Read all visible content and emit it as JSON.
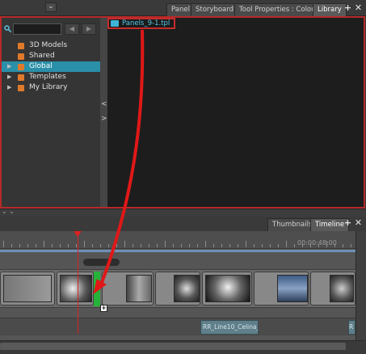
{
  "top_tabs": [
    {
      "label": "Panel",
      "active": false
    },
    {
      "label": "Storyboard",
      "active": false
    },
    {
      "label": "Tool Properties : Colour",
      "active": false
    },
    {
      "label": "Library",
      "active": true
    }
  ],
  "tab_add": "+",
  "tab_close": "✕",
  "library": {
    "search_value": "",
    "folders": [
      {
        "label": "3D Models",
        "expandable": false,
        "selected": false
      },
      {
        "label": "Shared",
        "expandable": false,
        "selected": false
      },
      {
        "label": "Global",
        "expandable": true,
        "selected": true
      },
      {
        "label": "Templates",
        "expandable": true,
        "selected": false
      },
      {
        "label": "My Library",
        "expandable": true,
        "selected": false
      }
    ],
    "template_item": "Panels_9-1.tpl"
  },
  "bottom_tabs": [
    {
      "label": "Thumbnails",
      "active": false
    },
    {
      "label": "Timeline",
      "active": true
    }
  ],
  "timeline": {
    "timecode": "00:00:48:00",
    "audio_clip": "RR_Line10_Celina_",
    "audio_clip_2": "R"
  },
  "colors": {
    "highlight_border": "#b62a2a",
    "selected_folder": "#2a8fa8",
    "drop_marker": "#26b23a",
    "arrow": "#e01818"
  },
  "icons": [
    "search-icon",
    "folder-icon",
    "template-file-icon",
    "drag-add-icon"
  ]
}
